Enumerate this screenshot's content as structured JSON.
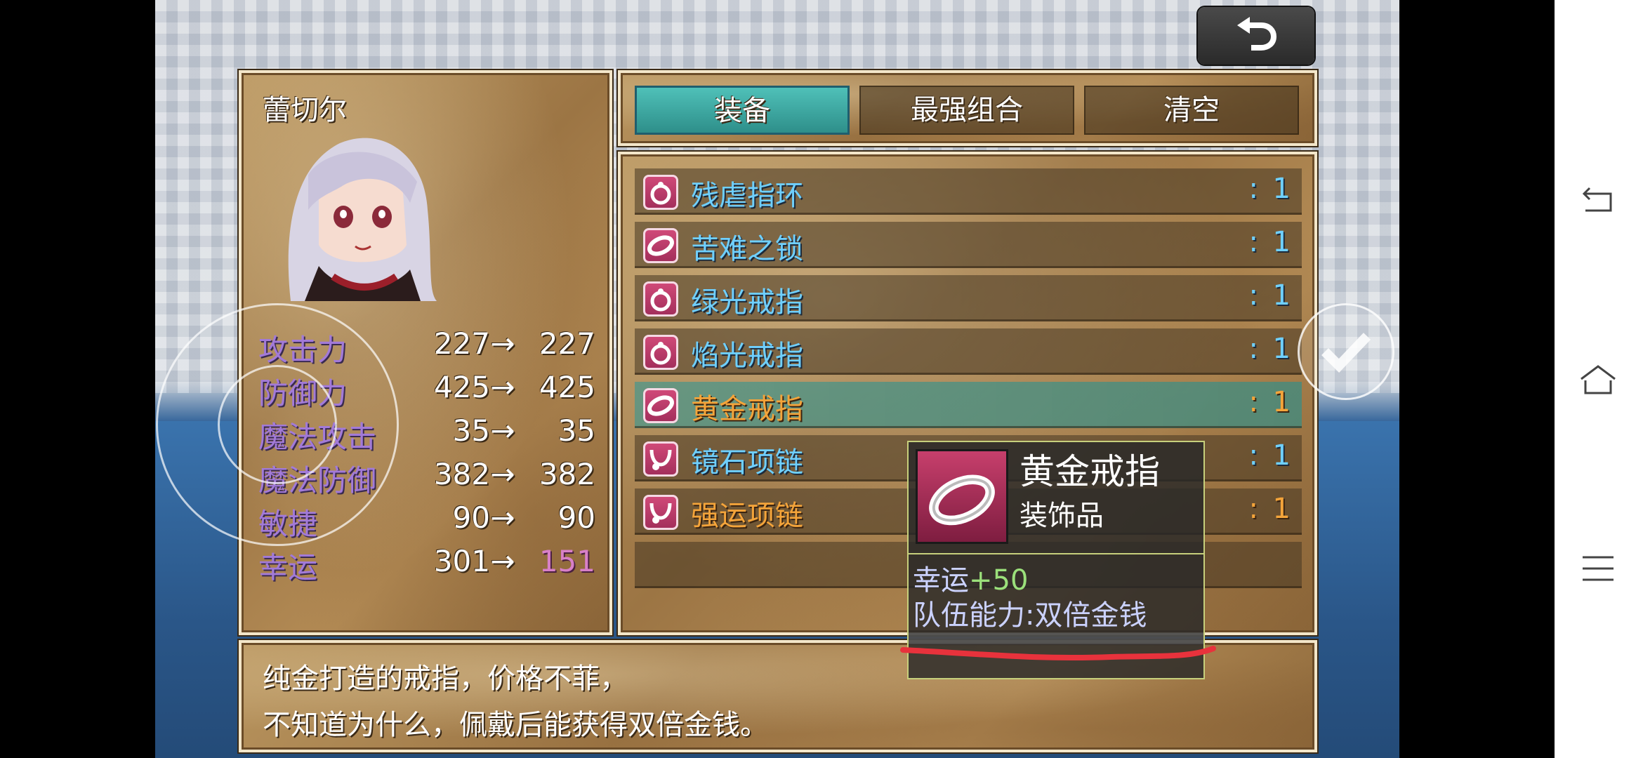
{
  "actor": {
    "name": "蕾切尔"
  },
  "stats": [
    {
      "label": "攻击力",
      "current": "227",
      "arrow": "→",
      "new": "227",
      "change": "same"
    },
    {
      "label": "防御力",
      "current": "425",
      "arrow": "→",
      "new": "425",
      "change": "same"
    },
    {
      "label": "魔法攻击",
      "current": "35",
      "arrow": "→",
      "new": "35",
      "change": "same"
    },
    {
      "label": "魔法防御",
      "current": "382",
      "arrow": "→",
      "new": "382",
      "change": "same"
    },
    {
      "label": "敏捷",
      "current": "90",
      "arrow": "→",
      "new": "90",
      "change": "same"
    },
    {
      "label": "幸运",
      "current": "301",
      "arrow": "→",
      "new": "151",
      "change": "down"
    }
  ],
  "commands": [
    {
      "label": "装备",
      "active": true
    },
    {
      "label": "最强组合",
      "active": false
    },
    {
      "label": "清空",
      "active": false
    }
  ],
  "items": [
    {
      "name": "残虐指环",
      "colon": ":",
      "count": "1",
      "icon": "ring-icon",
      "color": "blue"
    },
    {
      "name": "苦难之锁",
      "colon": ":",
      "count": "1",
      "icon": "band-icon",
      "color": "blue"
    },
    {
      "name": "绿光戒指",
      "colon": ":",
      "count": "1",
      "icon": "ring-icon",
      "color": "blue"
    },
    {
      "name": "焰光戒指",
      "colon": ":",
      "count": "1",
      "icon": "ring-icon",
      "color": "blue"
    },
    {
      "name": "黄金戒指",
      "colon": ":",
      "count": "1",
      "icon": "band-icon",
      "color": "orange",
      "selected": true
    },
    {
      "name": "镜石项链",
      "colon": ":",
      "count": "1",
      "icon": "necklace-icon",
      "color": "blue"
    },
    {
      "name": "强运项链",
      "colon": ":",
      "count": "1",
      "icon": "necklace-icon",
      "color": "orange"
    }
  ],
  "tooltip": {
    "name": "黄金戒指",
    "type": "装饰品",
    "effect_label": "幸运",
    "effect_value": "+50",
    "ability": "队伍能力:双倍金钱"
  },
  "help": {
    "line1": "纯金打造的戒指，价格不菲，",
    "line2": "不知道为什么，佩戴后能获得双倍金钱。"
  },
  "colors": {
    "stat_label": "#a27ad8",
    "item_blue": "#6fd0ff",
    "item_orange": "#f4a43a",
    "stat_down": "#d880c8",
    "annotation_red": "#e8323c"
  },
  "icons": {
    "back": "undo-arrow-icon",
    "confirm": "checkmark-icon",
    "nav_back": "nav-back-icon",
    "nav_home": "nav-home-icon",
    "nav_menu": "nav-menu-icon"
  }
}
